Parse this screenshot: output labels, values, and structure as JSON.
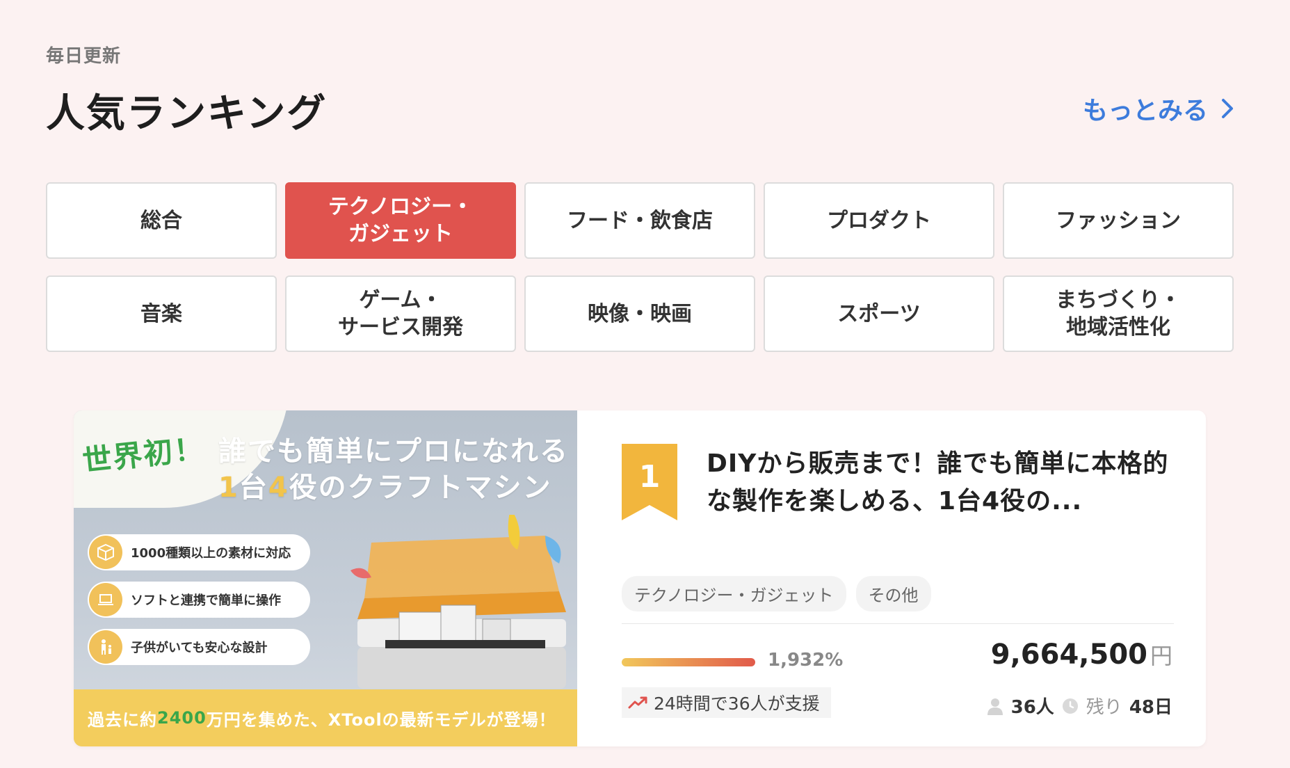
{
  "section": {
    "subtitle": "毎日更新",
    "title": "人気ランキング",
    "more_label": "もっとみる"
  },
  "categories": [
    {
      "label": "総合",
      "active": false
    },
    {
      "label": "テクノロジー・\nガジェット",
      "active": true
    },
    {
      "label": "フード・飲食店",
      "active": false
    },
    {
      "label": "プロダクト",
      "active": false
    },
    {
      "label": "ファッション",
      "active": false
    },
    {
      "label": "音楽",
      "active": false
    },
    {
      "label": "ゲーム・\nサービス開発",
      "active": false
    },
    {
      "label": "映像・映画",
      "active": false
    },
    {
      "label": "スポーツ",
      "active": false
    },
    {
      "label": "まちづくり・\n地域活性化",
      "active": false
    }
  ],
  "project": {
    "rank": "1",
    "title": "DIYから販売まで！誰でも簡単に本格的な製作を楽しめる、1台4役の...",
    "tags": [
      "テクノロジー・ガジェット",
      "その他"
    ],
    "progress_percent": 1932,
    "progress_label": "1,932%",
    "amount": "9,664,500",
    "currency": "円",
    "support_24h": "24時間で36人が支援",
    "supporters": "36人",
    "remaining_label": "残り",
    "remaining_days": "48日",
    "banner": {
      "badge": "世界初！",
      "headline1": "誰でも簡単にプロになれる",
      "headline2_num1": "1",
      "headline2_a": "台",
      "headline2_num2": "4",
      "headline2_b": "役のクラフトマシン",
      "features": [
        "1000種類以上の素材に対応",
        "ソフトと連携で簡単に操作",
        "子供がいても安心な設計"
      ],
      "footer_a": "過去に約",
      "footer_num": "2400",
      "footer_b": "万円を集めた、XToolの最新モデルが登場！"
    }
  },
  "colors": {
    "background": "#fcf2f2",
    "active_category": "#e0534e",
    "link": "#3d7cdc",
    "rank_ribbon": "#f2b63d"
  }
}
